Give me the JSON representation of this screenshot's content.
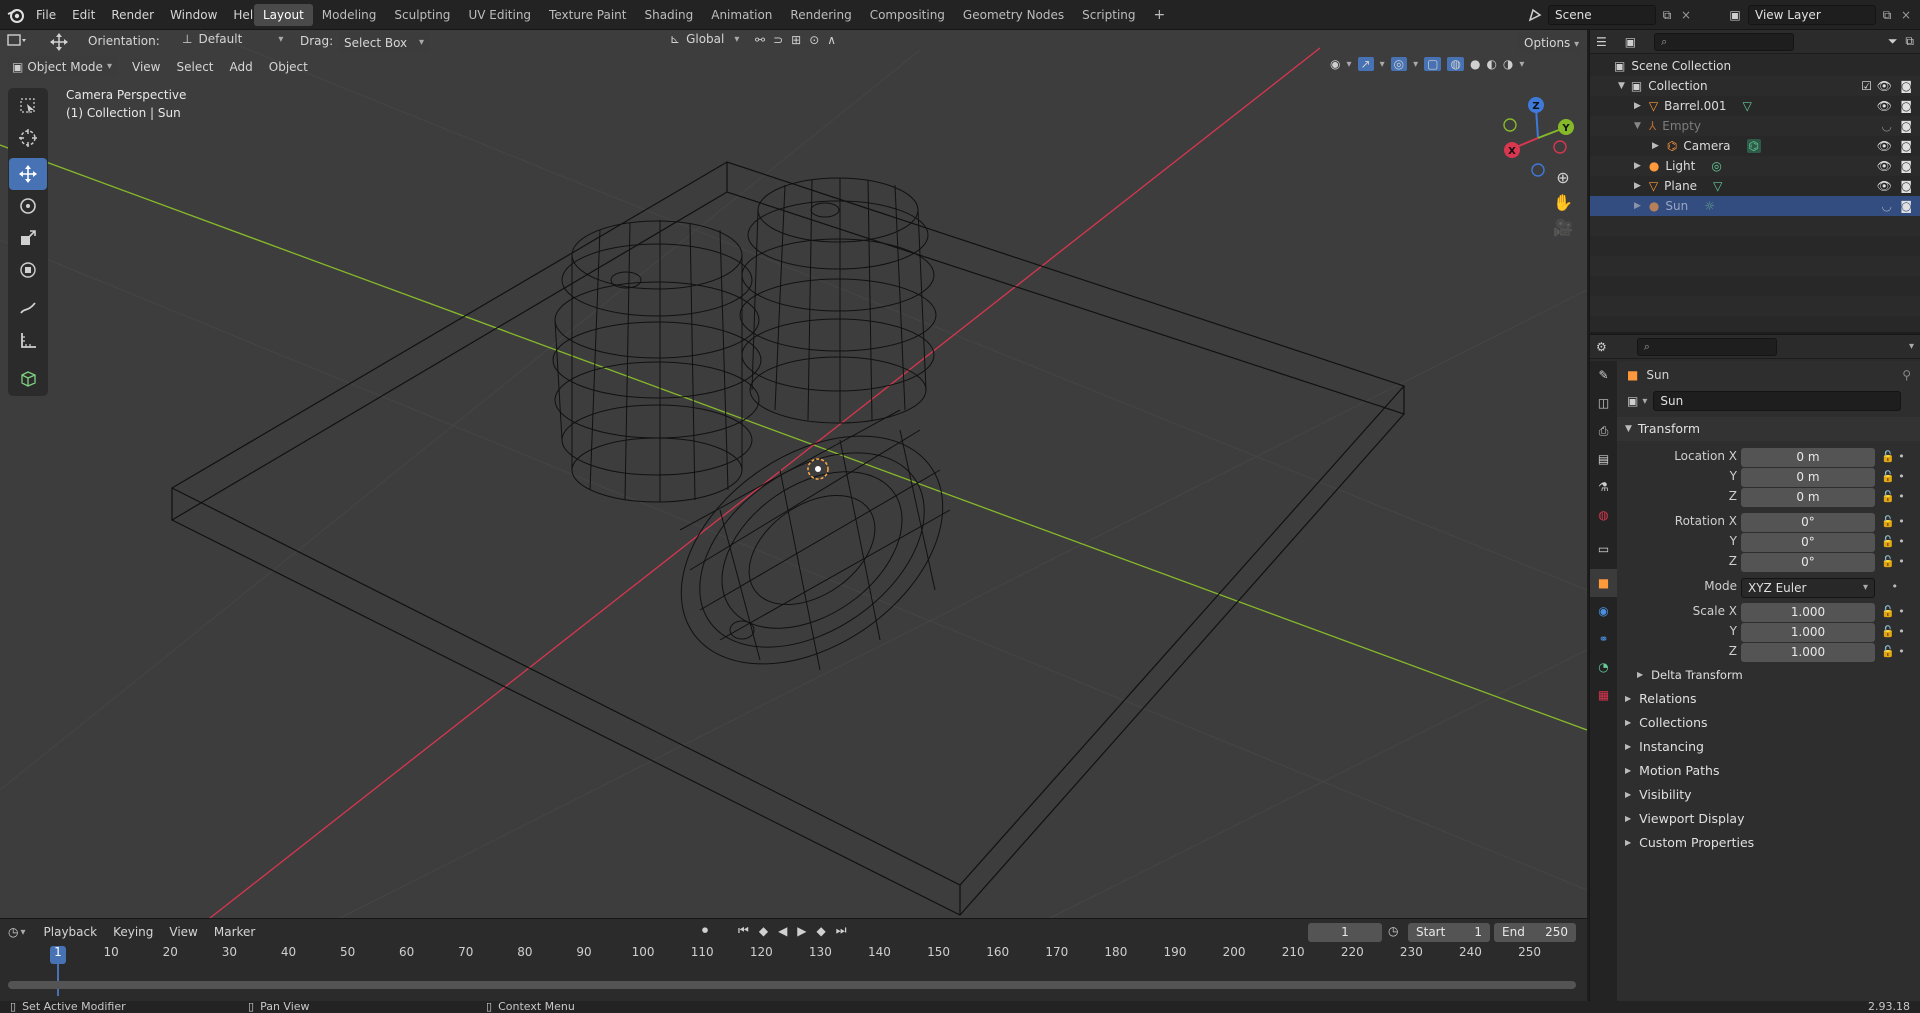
{
  "topbar": {
    "menus": [
      "File",
      "Edit",
      "Render",
      "Window",
      "Help"
    ],
    "workspaces": [
      "Layout",
      "Modeling",
      "Sculpting",
      "UV Editing",
      "Texture Paint",
      "Shading",
      "Animation",
      "Rendering",
      "Compositing",
      "Geometry Nodes",
      "Scripting"
    ],
    "active_workspace": "Layout",
    "add_workspace": "+",
    "scene_label": "Scene",
    "view_layer_label": "View Layer"
  },
  "tool_header": {
    "orientation_label": "Orientation:",
    "orientation_value": "Default",
    "drag_label": "Drag:",
    "drag_value": "Select Box",
    "transform_orientation": "Global",
    "options_label": "Options"
  },
  "viewport_header": {
    "mode": "Object Mode",
    "menus": [
      "View",
      "Select",
      "Add",
      "Object"
    ]
  },
  "viewport": {
    "overlay_title": "Camera Perspective",
    "overlay_subtitle": "(1) Collection | Sun",
    "gizmo": {
      "x": "X",
      "y": "Y",
      "z": "Z"
    },
    "colors": {
      "x_axis": "#d9364f",
      "y_axis": "#86b92a",
      "z_axis": "#3f79d9",
      "background": "#3d3d3d",
      "wire": "#0f0f0f"
    }
  },
  "outliner": {
    "root": "Scene Collection",
    "collection": "Collection",
    "items": [
      {
        "name": "Barrel.001",
        "icon": "mesh-icon",
        "extra": "mesh-data-icon"
      },
      {
        "name": "Empty",
        "icon": "empty-icon",
        "extra": ""
      },
      {
        "name": "Camera",
        "icon": "camera-icon",
        "extra": "camera-data-icon"
      },
      {
        "name": "Light",
        "icon": "light-icon",
        "extra": "light-data-icon"
      },
      {
        "name": "Plane",
        "icon": "mesh-icon",
        "extra": "mesh-data-icon"
      },
      {
        "name": "Sun",
        "icon": "light-icon",
        "extra": "sun-data-icon"
      }
    ],
    "selected": "Sun"
  },
  "properties": {
    "context_name": "Sun",
    "object_name": "Sun",
    "transform_title": "Transform",
    "location_label": "Location X",
    "rotation_label": "Rotation X",
    "scale_label": "Scale X",
    "axis_y": "Y",
    "axis_z": "Z",
    "location": [
      "0 m",
      "0 m",
      "0 m"
    ],
    "rotation": [
      "0°",
      "0°",
      "0°"
    ],
    "scale": [
      "1.000",
      "1.000",
      "1.000"
    ],
    "mode_label": "Mode",
    "mode_value": "XYZ Euler",
    "delta_transform": "Delta Transform",
    "panels": [
      "Relations",
      "Collections",
      "Instancing",
      "Motion Paths",
      "Visibility",
      "Viewport Display",
      "Custom Properties"
    ]
  },
  "timeline": {
    "menus": [
      "Playback",
      "Keying",
      "View",
      "Marker"
    ],
    "current_frame": "1",
    "start_label": "Start",
    "start_value": "1",
    "end_label": "End",
    "end_value": "250",
    "ruler": [
      "1",
      "10",
      "20",
      "30",
      "40",
      "50",
      "60",
      "70",
      "80",
      "90",
      "100",
      "110",
      "120",
      "130",
      "140",
      "150",
      "160",
      "170",
      "180",
      "190",
      "200",
      "210",
      "220",
      "230",
      "240",
      "250"
    ]
  },
  "statusbar": {
    "left": "Set Active Modifier",
    "middle": "Pan View",
    "right": "Context Menu",
    "version": "2.93.18"
  }
}
